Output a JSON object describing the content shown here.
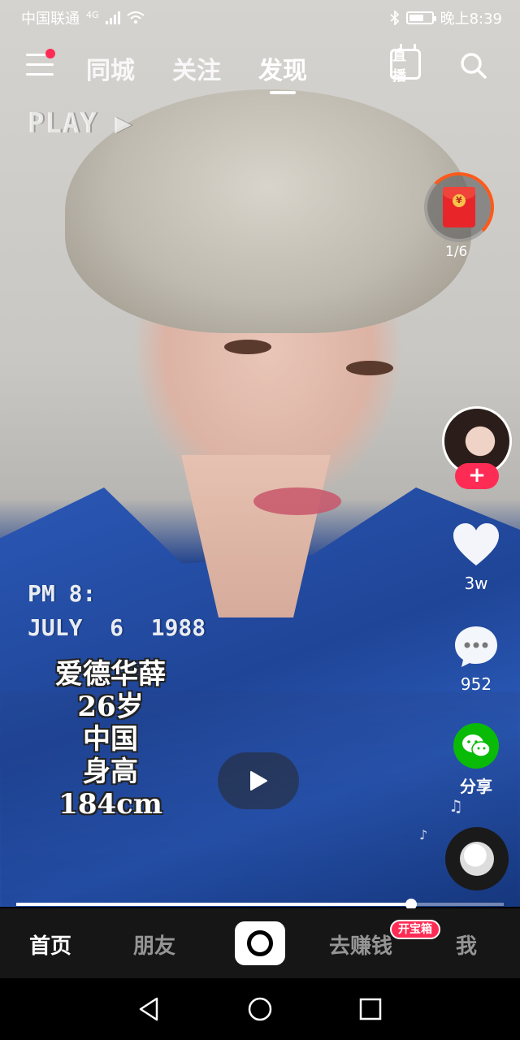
{
  "status_bar": {
    "carrier": "中国联通",
    "network": "4G",
    "time": "晚上8:39"
  },
  "top_nav": {
    "tabs": [
      {
        "label": "同城",
        "active": false
      },
      {
        "label": "关注",
        "active": false
      },
      {
        "label": "发现",
        "active": true
      }
    ],
    "live_label": "直播",
    "icons": [
      "menu-icon",
      "live-icon",
      "search-icon"
    ]
  },
  "video": {
    "overlay_top": "PLAY ▶",
    "overlay_time": "PM 8:",
    "overlay_date": "JULY  6  1988",
    "caption": [
      "爱德华薛",
      "26岁",
      "中国",
      "身高184cm"
    ],
    "progress": 0.81
  },
  "right_rail": {
    "red_packet_count": "1/6",
    "follow_label": "+",
    "like_count": "3w",
    "comment_count": "952",
    "share_label": "分享"
  },
  "bottom_tabs": {
    "home": "首页",
    "friends": "朋友",
    "earn": "去赚钱",
    "earn_badge": "开宝箱",
    "me": "我"
  },
  "colors": {
    "accent": "#fe2c55",
    "share_green": "#09bb07",
    "tabbar_bg": "#161616"
  }
}
